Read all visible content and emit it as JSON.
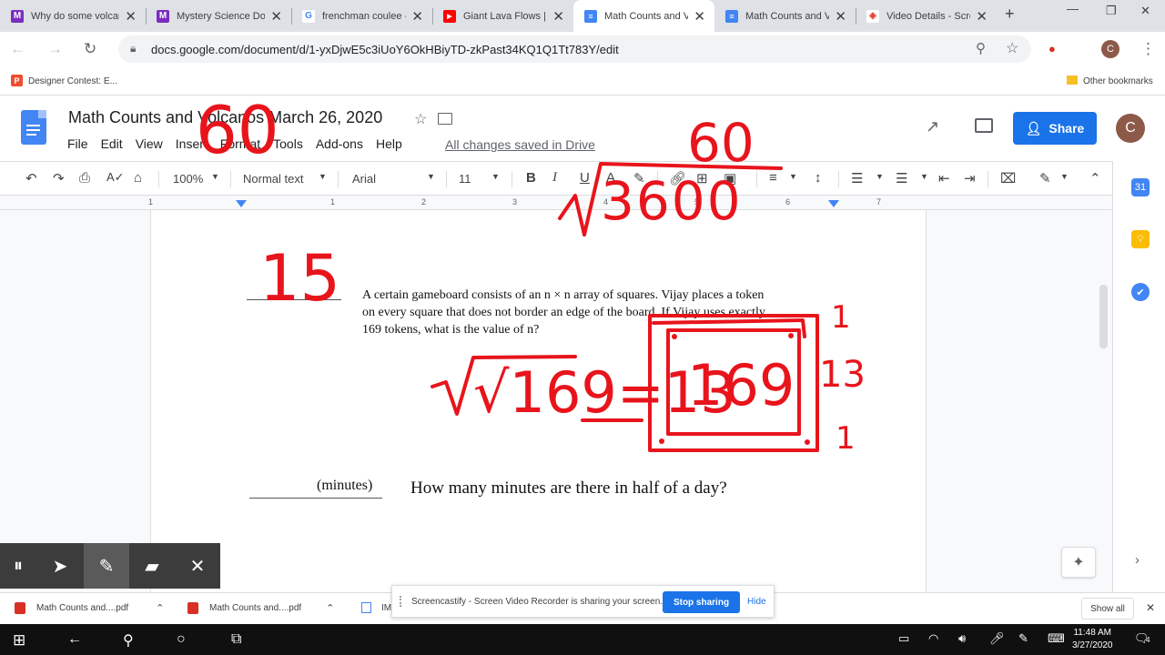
{
  "browser": {
    "tabs": [
      {
        "label": "Why do some volcan",
        "icon": "M",
        "color": "#7b2cbf"
      },
      {
        "label": "Mystery Science Doc",
        "icon": "M",
        "color": "#7b2cbf"
      },
      {
        "label": "frenchman coulee - ",
        "icon": "G",
        "color": "#4285f4"
      },
      {
        "label": "Giant Lava Flows | N",
        "icon": "▶",
        "color": "#ff0000"
      },
      {
        "label": "Math Counts and Vo",
        "icon": "≡",
        "color": "#4285f4"
      },
      {
        "label": "Math Counts and Vo",
        "icon": "≡",
        "color": "#4285f4"
      },
      {
        "label": "Video Details - Scre",
        "icon": "◈",
        "color": "#ea4335"
      }
    ],
    "url": "docs.google.com/document/d/1-yxDjwE5c3iUoY6OkHBiyTD-zkPast34KQ1Q1Tt783Y/edit",
    "bookmark": "Designer Contest: E...",
    "other_bookmarks": "Other bookmarks",
    "profile_initial": "C"
  },
  "docs": {
    "title": "Math Counts and Volcanos March 26, 2020",
    "menu": [
      "File",
      "Edit",
      "View",
      "Insert",
      "Format",
      "Tools",
      "Add-ons",
      "Help"
    ],
    "saved_status": "All changes saved in Drive",
    "share_label": "Share",
    "avatar_initial": "C"
  },
  "toolbar": {
    "zoom": "100%",
    "style": "Normal text",
    "font": "Arial",
    "font_size": "11"
  },
  "ruler": {
    "numbers": [
      "1",
      "1",
      "2",
      "3",
      "4",
      "5",
      "6",
      "7"
    ]
  },
  "document": {
    "problem1": {
      "line1": "A certain gameboard consists of an n × n array of squares. Vijay places a token",
      "line2": "on every square that does not border an edge of the board. If Vijay uses exactly",
      "line3": "169 tokens, what is the value of n?"
    },
    "problem2": {
      "unit": "(minutes)",
      "question": "How many minutes are there in half of a day?"
    },
    "ink": {
      "answer1": "15",
      "top_60": "60",
      "top_60b": "60",
      "division": "3600",
      "sqrt": "√169=13",
      "box_label": "169",
      "side_13": "13",
      "side_1a": "1",
      "side_1b": "1"
    }
  },
  "screencastify": {
    "notice": "Screencastify - Screen Video Recorder is sharing your screen.",
    "stop": "Stop sharing",
    "hide": "Hide"
  },
  "downloads": {
    "items": [
      "Math Counts and....pdf",
      "Math Counts and....pdf",
      "IM"
    ],
    "show_all": "Show all"
  },
  "taskbar": {
    "time": "11:48 AM",
    "date": "3/27/2020",
    "notifications": "4"
  },
  "colors": {
    "ink": "#e8141c",
    "accent": "#1a73e8"
  }
}
